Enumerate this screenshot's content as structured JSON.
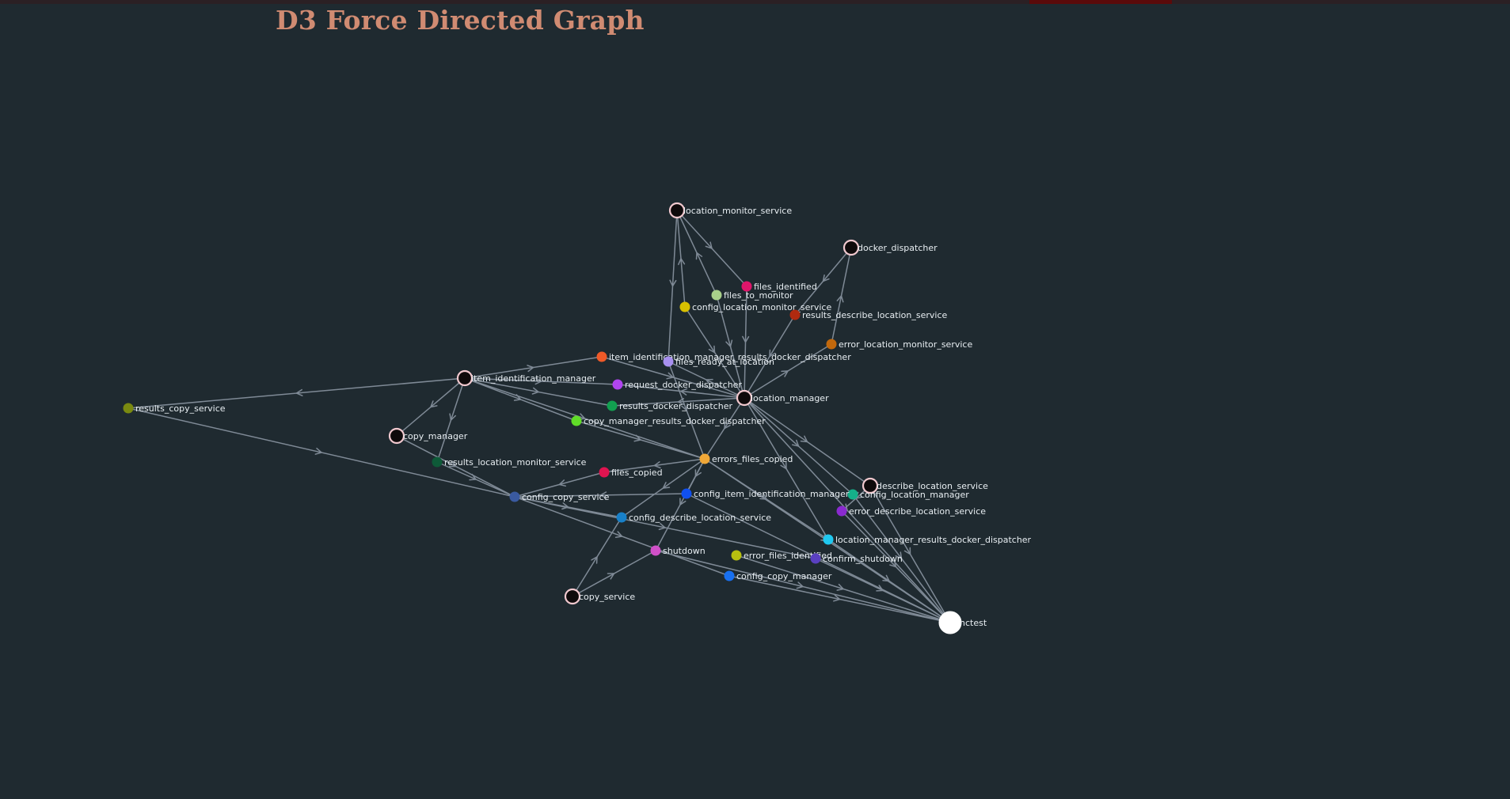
{
  "title": "D3 Force Directed Graph",
  "colors": {
    "background": "#1f2a30",
    "title": "#d08b72",
    "link": "#7f8a96",
    "service_fill": "#0f0a0b",
    "service_stroke": "#f2c9cf",
    "label": "#e8eef2"
  },
  "nodes": [
    {
      "id": "location_monitor_service",
      "kind": "service",
      "color": ""
    },
    {
      "id": "docker_dispatcher",
      "kind": "service",
      "color": ""
    },
    {
      "id": "files_identified",
      "kind": "topic",
      "color": "#e0156b"
    },
    {
      "id": "files_to_monitor",
      "kind": "topic",
      "color": "#a8d08a"
    },
    {
      "id": "config_location_monitor_service",
      "kind": "topic",
      "color": "#d8c000"
    },
    {
      "id": "results_describe_location_service",
      "kind": "topic",
      "color": "#b02a10"
    },
    {
      "id": "error_location_monitor_service",
      "kind": "topic",
      "color": "#c2680c"
    },
    {
      "id": "item_identification_manager_results_docker_dispatcher",
      "kind": "topic",
      "color": "#f05a28"
    },
    {
      "id": "files_ready_at_location",
      "kind": "topic",
      "color": "#a890f0"
    },
    {
      "id": "item_identification_manager",
      "kind": "service",
      "color": ""
    },
    {
      "id": "request_docker_dispatcher",
      "kind": "topic",
      "color": "#b045f0"
    },
    {
      "id": "location_manager",
      "kind": "service",
      "color": ""
    },
    {
      "id": "results_docker_dispatcher",
      "kind": "topic",
      "color": "#12a050"
    },
    {
      "id": "results_copy_service",
      "kind": "topic",
      "color": "#7a8a10"
    },
    {
      "id": "copy_manager_results_docker_dispatcher",
      "kind": "topic",
      "color": "#60dc28"
    },
    {
      "id": "copy_manager",
      "kind": "service",
      "color": ""
    },
    {
      "id": "errors_files_copied",
      "kind": "topic",
      "color": "#f0a838"
    },
    {
      "id": "results_location_monitor_service",
      "kind": "topic",
      "color": "#0e5a38"
    },
    {
      "id": "files_copied",
      "kind": "topic",
      "color": "#e01450"
    },
    {
      "id": "describe_location_service",
      "kind": "service",
      "color": ""
    },
    {
      "id": "config_location_manager",
      "kind": "topic",
      "color": "#15b08a"
    },
    {
      "id": "config_item_identification_manager",
      "kind": "topic",
      "color": "#1050f0"
    },
    {
      "id": "config_copy_service",
      "kind": "topic",
      "color": "#3a5aa0"
    },
    {
      "id": "error_describe_location_service",
      "kind": "topic",
      "color": "#8a2ad0"
    },
    {
      "id": "config_describe_location_service",
      "kind": "topic",
      "color": "#1880c8"
    },
    {
      "id": "location_manager_results_docker_dispatcher",
      "kind": "topic",
      "color": "#20c8f0"
    },
    {
      "id": "shutdown",
      "kind": "topic",
      "color": "#d050c8"
    },
    {
      "id": "error_files_identified",
      "kind": "topic",
      "color": "#b8c010"
    },
    {
      "id": "confirm_shutdown",
      "kind": "topic",
      "color": "#5a40c0"
    },
    {
      "id": "config_copy_manager",
      "kind": "topic",
      "color": "#1870f0"
    },
    {
      "id": "copy_service",
      "kind": "service",
      "color": ""
    },
    {
      "id": "nctest",
      "kind": "root",
      "color": "#ffffff"
    }
  ],
  "links": [
    [
      "location_monitor_service",
      "files_identified"
    ],
    [
      "files_to_monitor",
      "location_monitor_service"
    ],
    [
      "config_location_monitor_service",
      "location_monitor_service"
    ],
    [
      "location_monitor_service",
      "files_ready_at_location"
    ],
    [
      "docker_dispatcher",
      "results_describe_location_service"
    ],
    [
      "error_location_monitor_service",
      "docker_dispatcher"
    ],
    [
      "files_identified",
      "location_manager"
    ],
    [
      "files_to_monitor",
      "location_manager"
    ],
    [
      "config_location_monitor_service",
      "location_manager"
    ],
    [
      "results_describe_location_service",
      "location_manager"
    ],
    [
      "location_manager",
      "error_location_monitor_service"
    ],
    [
      "item_identification_manager",
      "item_identification_manager_results_docker_dispatcher"
    ],
    [
      "item_identification_manager_results_docker_dispatcher",
      "location_manager"
    ],
    [
      "location_manager",
      "files_ready_at_location"
    ],
    [
      "location_manager",
      "request_docker_dispatcher"
    ],
    [
      "location_manager",
      "results_docker_dispatcher"
    ],
    [
      "item_identification_manager",
      "request_docker_dispatcher"
    ],
    [
      "item_identification_manager",
      "results_docker_dispatcher"
    ],
    [
      "item_identification_manager",
      "results_copy_service"
    ],
    [
      "item_identification_manager",
      "copy_manager_results_docker_dispatcher"
    ],
    [
      "item_identification_manager",
      "copy_manager"
    ],
    [
      "item_identification_manager",
      "results_location_monitor_service"
    ],
    [
      "copy_manager_results_docker_dispatcher",
      "errors_files_copied"
    ],
    [
      "item_identification_manager",
      "errors_files_copied"
    ],
    [
      "files_ready_at_location",
      "errors_files_copied"
    ],
    [
      "location_manager",
      "errors_files_copied"
    ],
    [
      "results_copy_service",
      "config_copy_service"
    ],
    [
      "copy_manager",
      "config_copy_service"
    ],
    [
      "results_location_monitor_service",
      "config_copy_service"
    ],
    [
      "errors_files_copied",
      "files_copied"
    ],
    [
      "files_copied",
      "config_copy_service"
    ],
    [
      "config_item_identification_manager",
      "config_copy_service"
    ],
    [
      "errors_files_copied",
      "config_item_identification_manager"
    ],
    [
      "errors_files_copied",
      "config_describe_location_service"
    ],
    [
      "errors_files_copied",
      "shutdown"
    ],
    [
      "config_copy_service",
      "config_describe_location_service"
    ],
    [
      "config_copy_service",
      "confirm_shutdown"
    ],
    [
      "config_copy_service",
      "config_copy_manager"
    ],
    [
      "copy_service",
      "config_describe_location_service"
    ],
    [
      "copy_service",
      "shutdown"
    ],
    [
      "shutdown",
      "nctest"
    ],
    [
      "error_files_identified",
      "nctest"
    ],
    [
      "confirm_shutdown",
      "nctest"
    ],
    [
      "config_copy_manager",
      "nctest"
    ],
    [
      "location_manager_results_docker_dispatcher",
      "nctest"
    ],
    [
      "error_describe_location_service",
      "nctest"
    ],
    [
      "config_location_manager",
      "nctest"
    ],
    [
      "describe_location_service",
      "nctest"
    ],
    [
      "location_manager",
      "describe_location_service"
    ],
    [
      "location_manager",
      "config_location_manager"
    ],
    [
      "location_manager",
      "nctest"
    ],
    [
      "errors_files_copied",
      "nctest"
    ],
    [
      "errors_files_copied",
      "location_manager_results_docker_dispatcher"
    ],
    [
      "config_item_identification_manager",
      "nctest"
    ],
    [
      "describe_location_service",
      "error_describe_location_service"
    ],
    [
      "location_manager",
      "location_manager_results_docker_dispatcher"
    ]
  ]
}
